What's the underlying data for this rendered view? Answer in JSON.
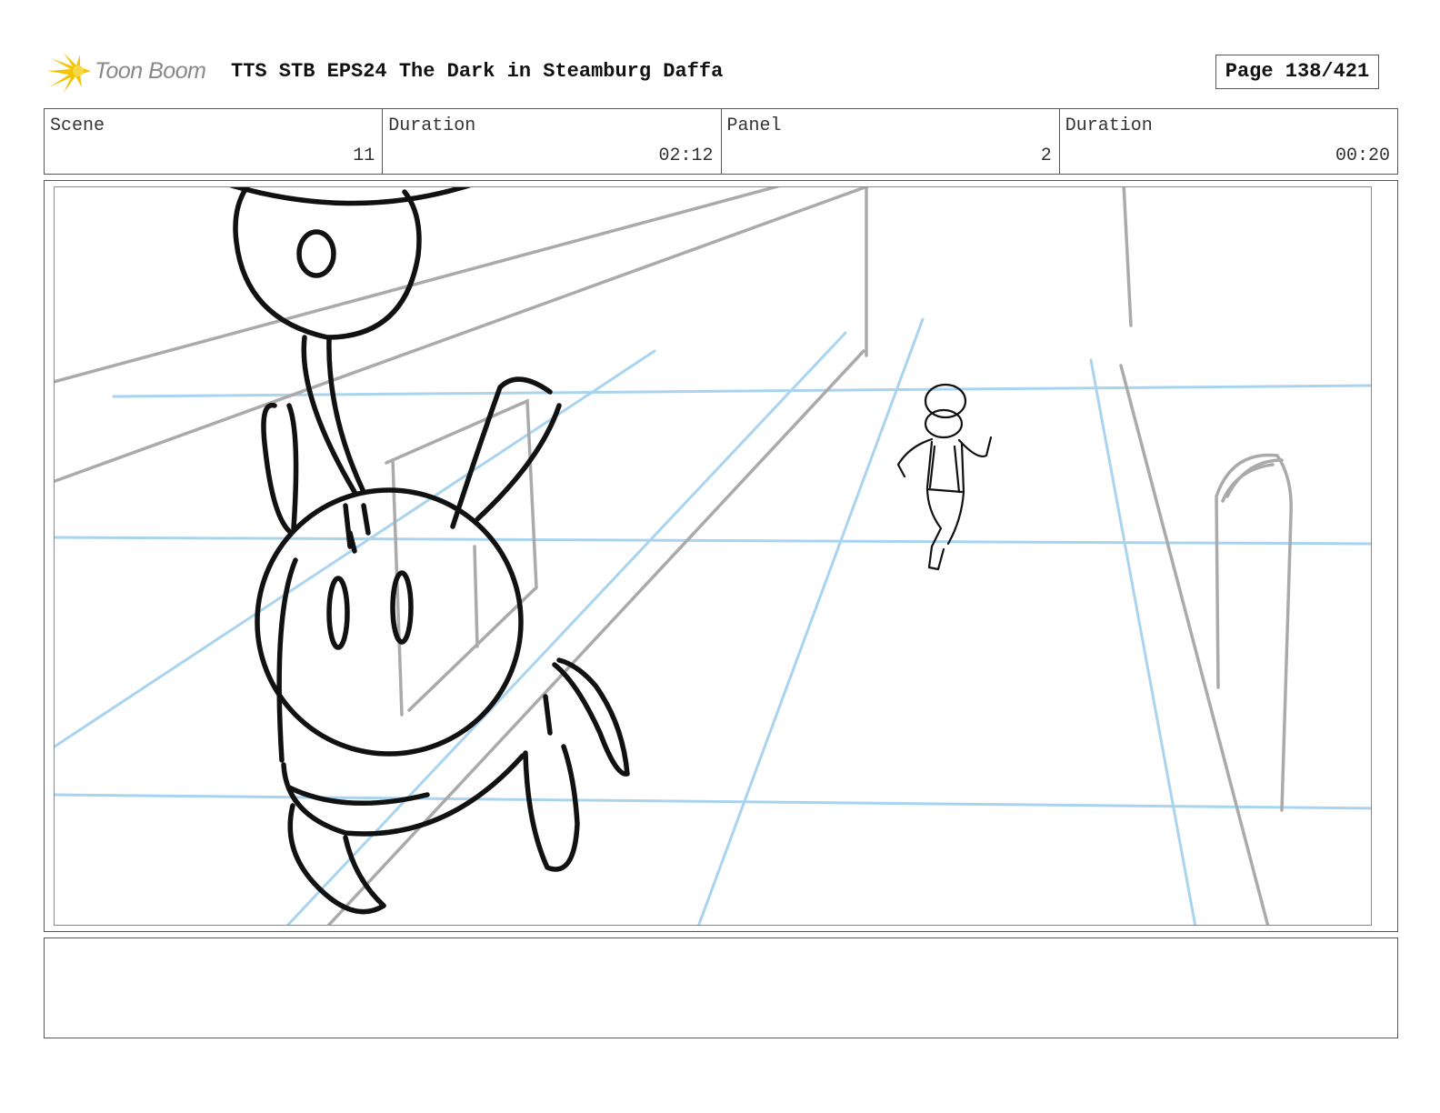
{
  "header": {
    "logo_text": "Toon Boom",
    "title": "TTS STB EPS24 The Dark in Steamburg Daffa",
    "page": "Page 138/421"
  },
  "info": {
    "scene_label": "Scene",
    "scene_value": "11",
    "scene_duration_label": "Duration",
    "scene_duration_value": "02:12",
    "panel_label": "Panel",
    "panel_value": "2",
    "panel_duration_label": "Duration",
    "panel_duration_value": "00:20"
  },
  "notes": {
    "text": ""
  },
  "colors": {
    "guide_blue": "#a9d4ef",
    "sketch_grey": "#aaaaaa",
    "ink": "#111111",
    "logo_yellow": "#f5c400"
  }
}
